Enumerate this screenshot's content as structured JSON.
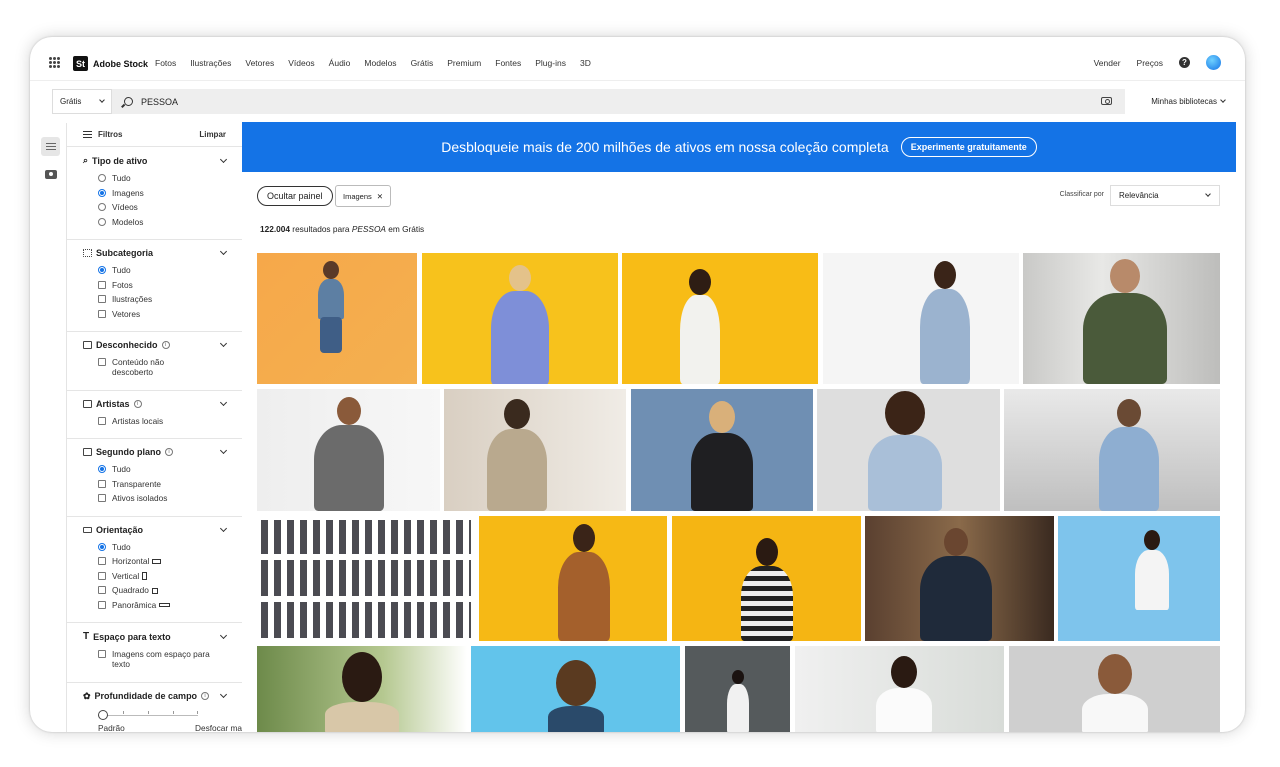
{
  "brand": {
    "mark": "St",
    "name": "Adobe Stock"
  },
  "nav": {
    "links": [
      "Fotos",
      "Ilustrações",
      "Vetores",
      "Vídeos",
      "Áudio",
      "Modelos",
      "Grátis",
      "Premium",
      "Fontes",
      "Plug-ins",
      "3D"
    ],
    "vender": "Vender",
    "precos": "Preços",
    "help": "?"
  },
  "search": {
    "scope": "Grátis",
    "query": "PESSOA",
    "libraries": "Minhas bibliotecas"
  },
  "filters": {
    "title": "Filtros",
    "clear": "Limpar",
    "tipo": {
      "title": "Tipo de ativo",
      "options": [
        "Tudo",
        "Imagens",
        "Vídeos",
        "Modelos"
      ]
    },
    "sub": {
      "title": "Subcategoria",
      "options": [
        "Tudo",
        "Fotos",
        "Ilustrações",
        "Vetores"
      ]
    },
    "desc": {
      "title": "Desconhecido",
      "option": "Conteúdo não descoberto"
    },
    "art": {
      "title": "Artistas",
      "option": "Artistas locais"
    },
    "seg": {
      "title": "Segundo plano",
      "options": [
        "Tudo",
        "Transparente",
        "Ativos isolados"
      ]
    },
    "ori": {
      "title": "Orientação",
      "options": [
        "Tudo",
        "Horizontal",
        "Vertical",
        "Quadrado",
        "Panorâmica"
      ]
    },
    "esp": {
      "title": "Espaço para texto",
      "option": "Imagens com espaço para texto"
    },
    "prof": {
      "title": "Profundidade de campo",
      "min": "Padrão",
      "max": "Desfocar mais",
      "level": 0
    }
  },
  "banner": {
    "text": "Desbloqueie mais de 200 milhões de ativos em nossa coleção completa",
    "cta": "Experimente gratuitamente"
  },
  "toolbar": {
    "hide_panel": "Ocultar painel",
    "tag": "Imagens",
    "tag_close": "✕",
    "sort_label": "Classificar por",
    "sort_value": "Relevância"
  },
  "results": {
    "count": "122.004",
    "mid": " resultados para ",
    "query": "PESSOA",
    "suffix": " em Grátis"
  },
  "colors": {
    "accent": "#1473e6",
    "banner": "#1473e6"
  }
}
